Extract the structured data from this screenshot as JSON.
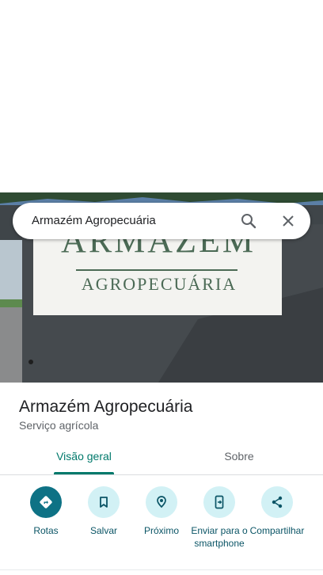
{
  "search": {
    "query": "Armazém Agropecuária"
  },
  "photo": {
    "sign_line1": "ARMAZÉM",
    "sign_line2": "AGROPECUÁRIA"
  },
  "place": {
    "name": "Armazém Agropecuária",
    "category": "Serviço agrícola"
  },
  "tabs": [
    {
      "label": "Visão geral",
      "active": true
    },
    {
      "label": "Sobre",
      "active": false
    }
  ],
  "actions": [
    {
      "label": "Rotas",
      "icon": "directions-icon"
    },
    {
      "label": "Salvar",
      "icon": "bookmark-icon"
    },
    {
      "label": "Próximo",
      "icon": "nearby-icon"
    },
    {
      "label": "Enviar para o smartphone",
      "icon": "send-to-phone-icon"
    },
    {
      "label": "Compartilhar",
      "icon": "share-icon"
    }
  ],
  "colors": {
    "accent": "#00796b",
    "primary_button": "#0e7285",
    "button_tint": "#d2f1f5"
  }
}
